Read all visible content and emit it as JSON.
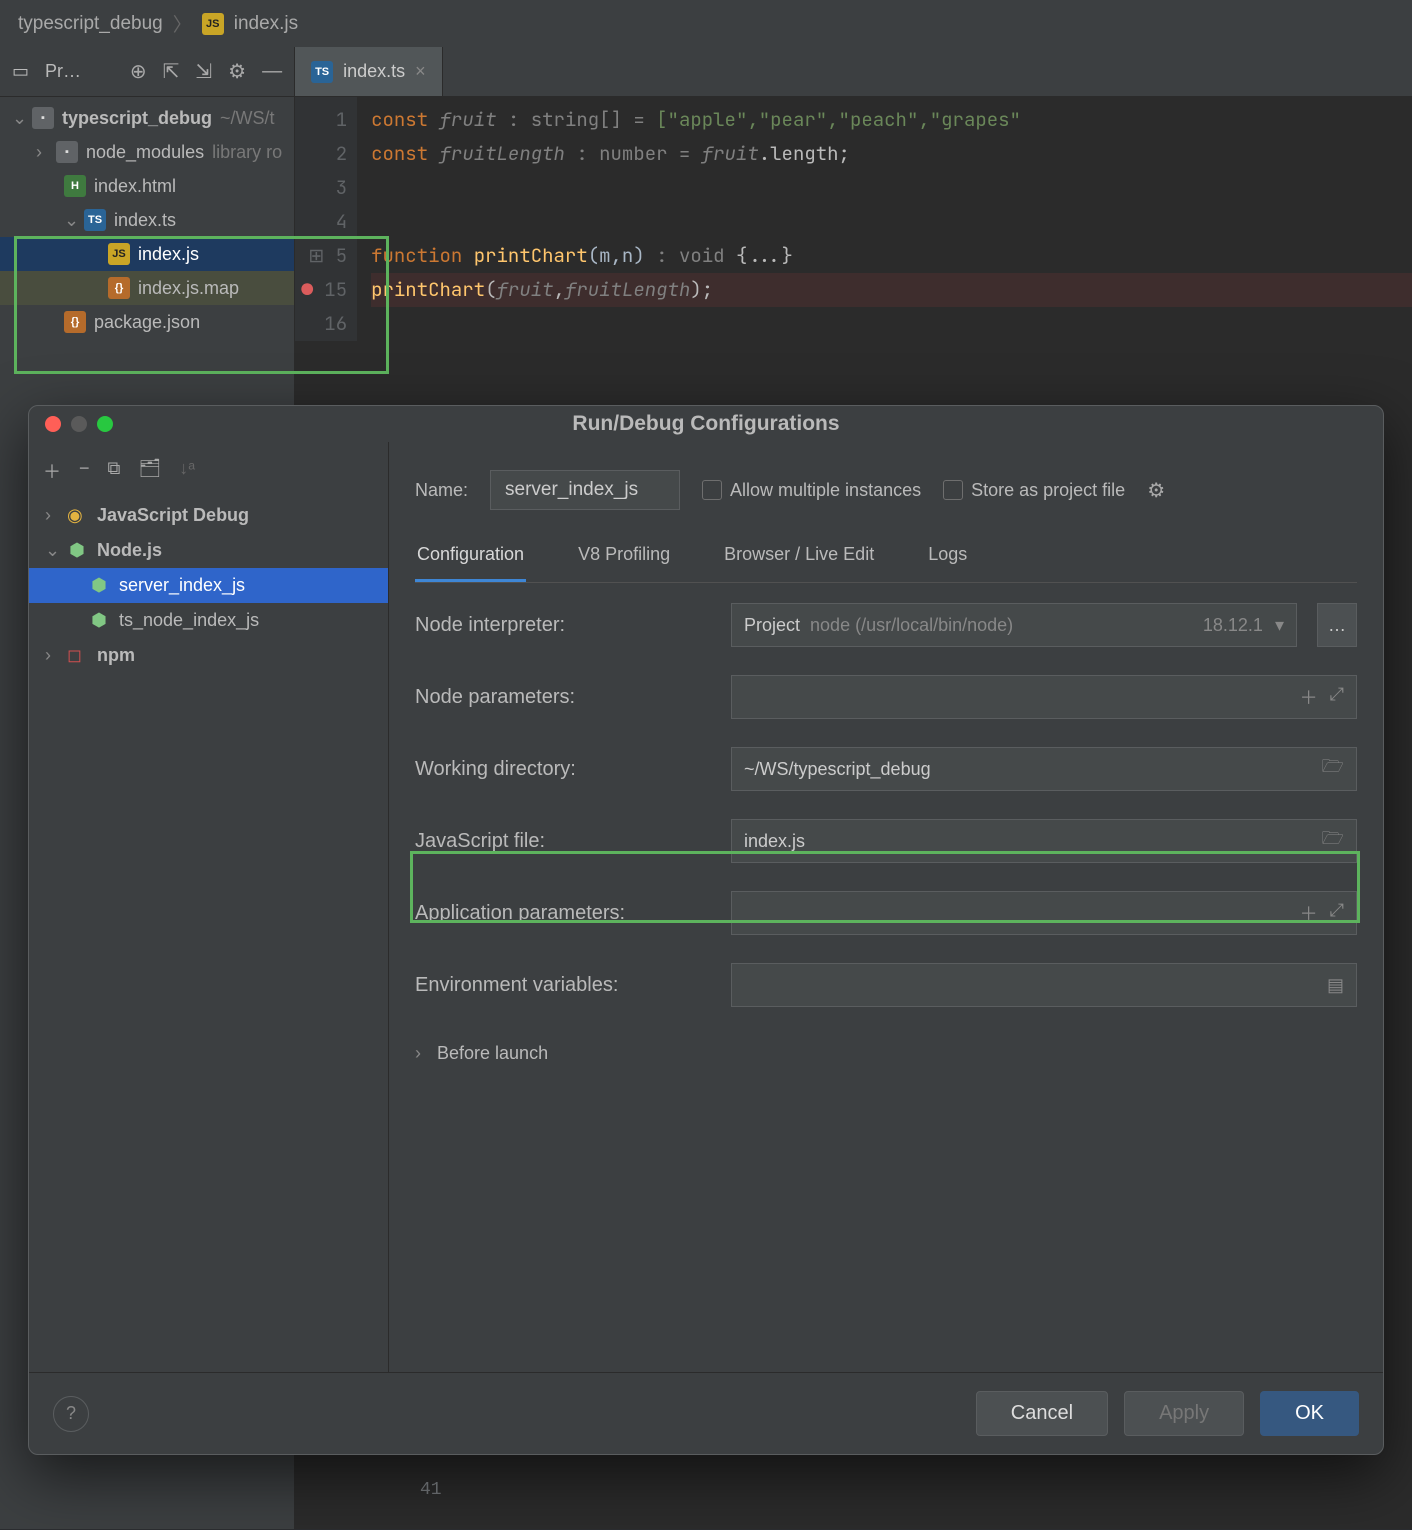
{
  "breadcrumb": {
    "project": "typescript_debug",
    "file": "index.js"
  },
  "sidebar": {
    "title": "Pr…",
    "root": "typescript_debug",
    "root_suffix": "~/WS/t",
    "items": [
      {
        "label": "node_modules",
        "suffix": "library ro",
        "indent": 1,
        "chev": "›",
        "ico": "folder"
      },
      {
        "label": "index.html",
        "indent": 2,
        "ico": "html"
      },
      {
        "label": "index.ts",
        "indent": 2,
        "chev": "⌄",
        "ico": "ts"
      },
      {
        "label": "index.js",
        "indent": 3,
        "ico": "js",
        "sel": true
      },
      {
        "label": "index.js.map",
        "indent": 3,
        "ico": "json",
        "soft": true
      },
      {
        "label": "package.json",
        "indent": 2,
        "ico": "json"
      }
    ]
  },
  "editor": {
    "tab": "index.ts",
    "lines": [
      "1",
      "2",
      "3",
      "4",
      "5",
      "15",
      "16"
    ],
    "code": {
      "l1_pre": "const ",
      "l1_var": "fruit",
      "l1_type": " : string[]  = ",
      "l1_val": "[\"apple\",\"pear\",\"peach\",\"grapes\"",
      "l2_pre": "const ",
      "l2_var": "fruitLength",
      "l2_type": " : number  = ",
      "l2_ref": "fruit",
      "l2_tail": ".length;",
      "l5_pre": "function ",
      "l5_fn": "printChart",
      "l5_params": "(m,n)",
      "l5_type": " : void  ",
      "l5_body": "{...}",
      "l15_fn": "printChart",
      "l15_args_a": "fruit",
      "l15_args_b": "fruitLength",
      "l15_tail": ");"
    }
  },
  "dialog": {
    "title": "Run/Debug Configurations",
    "left": {
      "items": [
        {
          "label": "JavaScript Debug",
          "chev": "›",
          "ico": "js"
        },
        {
          "label": "Node.js",
          "chev": "⌄",
          "ico": "node",
          "bold": true
        },
        {
          "label": "server_index_js",
          "indent": true,
          "ico": "node",
          "sel": true
        },
        {
          "label": "ts_node_index_js",
          "indent": true,
          "ico": "node"
        },
        {
          "label": "npm",
          "chev": "›",
          "ico": "npm"
        }
      ]
    },
    "name_label": "Name:",
    "name_value": "server_index_js",
    "allow_multiple": "Allow multiple instances",
    "store_file": "Store as project file",
    "tabs": [
      "Configuration",
      "V8 Profiling",
      "Browser / Live Edit",
      "Logs"
    ],
    "fields": {
      "node_interpreter": {
        "label": "Node interpreter:",
        "prefix": "Project",
        "value": "node (/usr/local/bin/node)",
        "version": "18.12.1"
      },
      "node_parameters": {
        "label": "Node parameters:",
        "value": ""
      },
      "working_dir": {
        "label": "Working directory:",
        "value": "~/WS/typescript_debug"
      },
      "js_file": {
        "label": "JavaScript file:",
        "value": "index.js"
      },
      "app_params": {
        "label": "Application parameters:",
        "value": ""
      },
      "env_vars": {
        "label": "Environment variables:",
        "value": ""
      }
    },
    "before_launch": "Before launch",
    "buttons": {
      "cancel": "Cancel",
      "apply": "Apply",
      "ok": "OK"
    }
  }
}
